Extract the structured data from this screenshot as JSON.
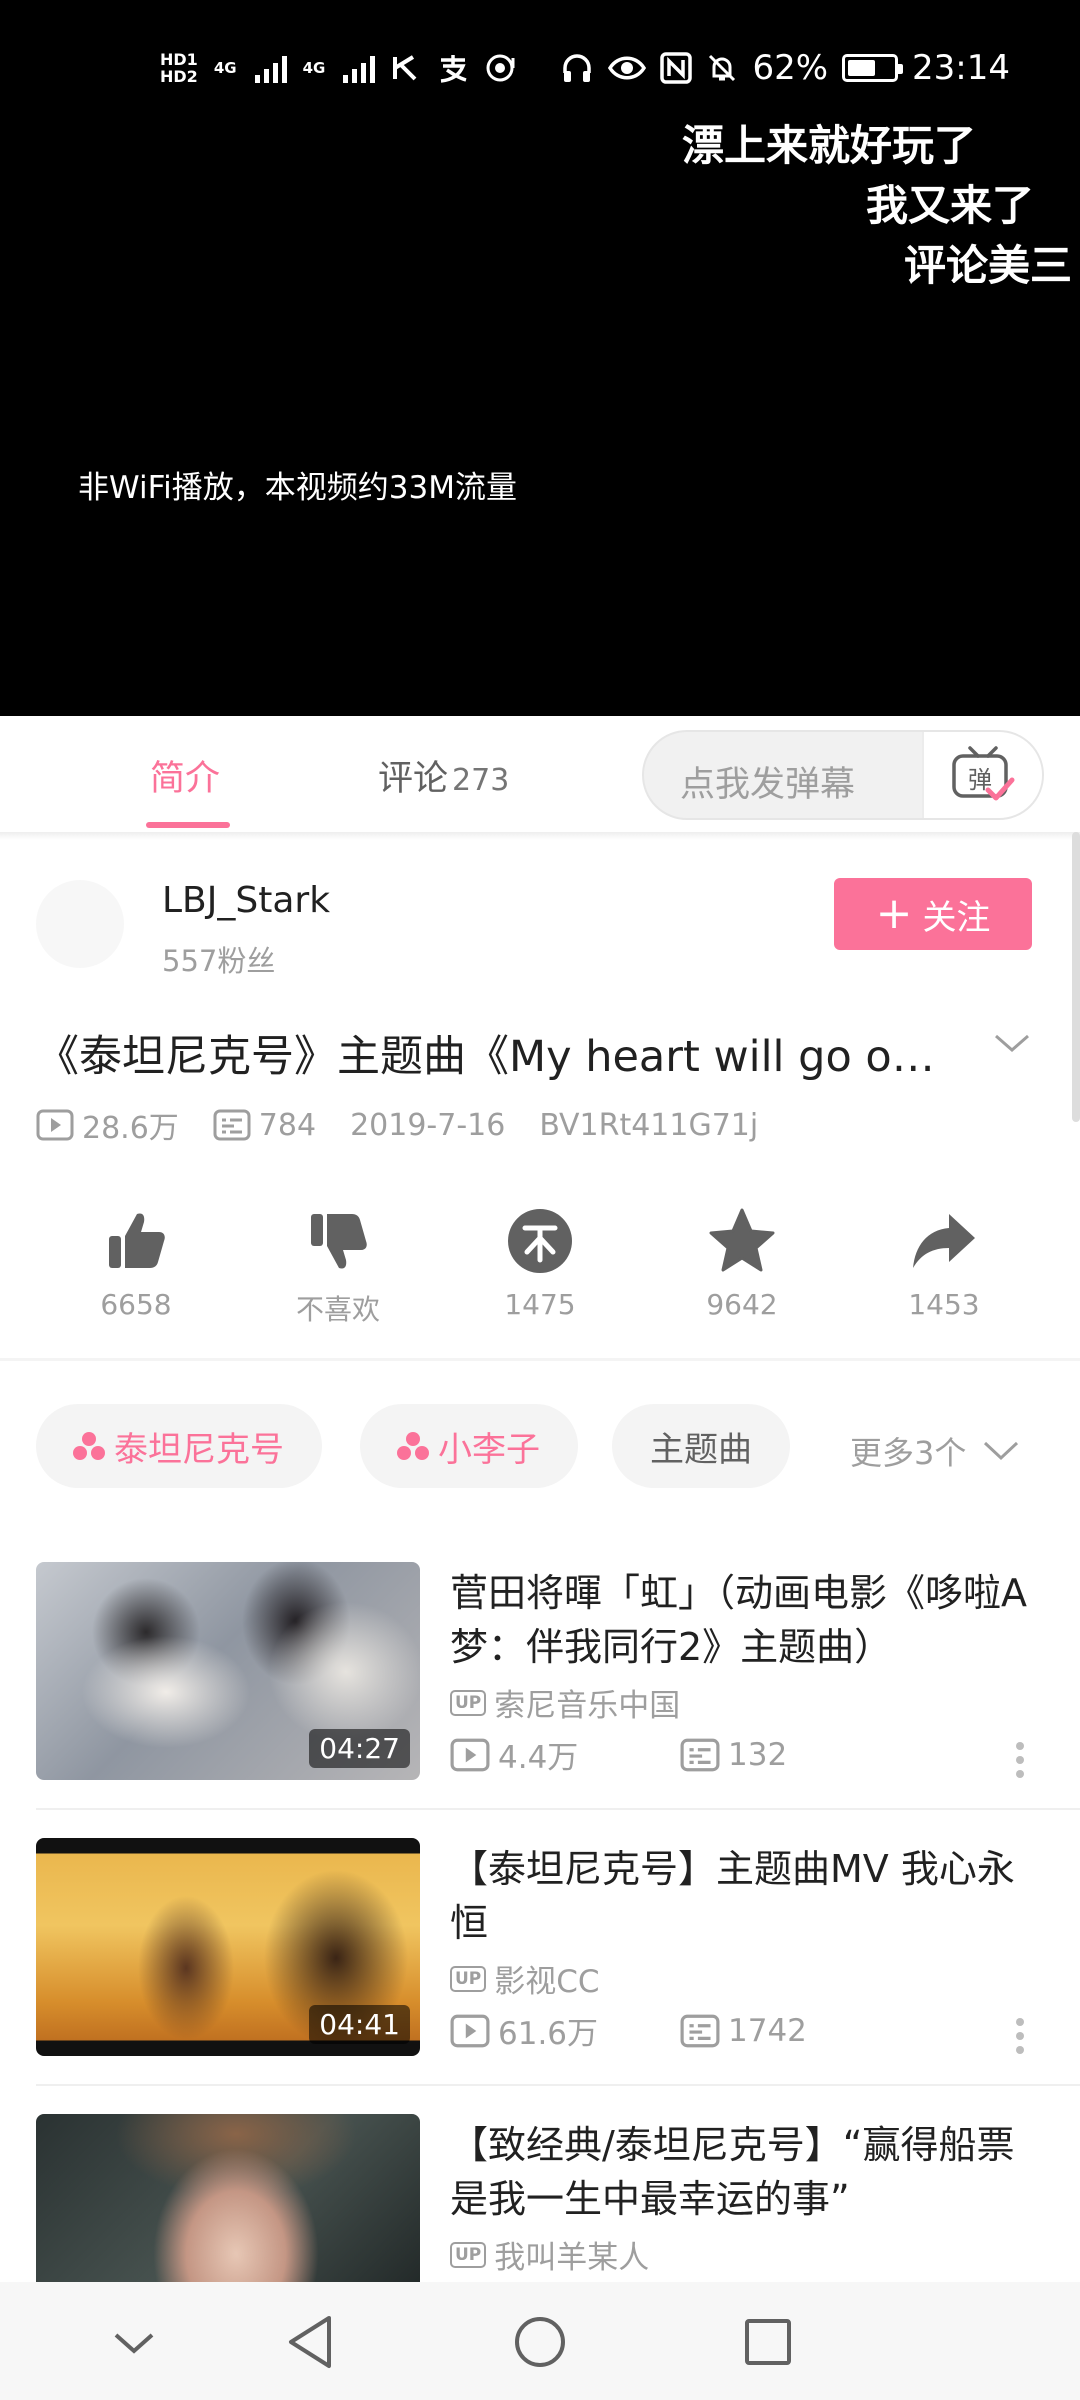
{
  "status_bar": {
    "hd1": "HD1",
    "hd2": "HD2",
    "net1": "4G",
    "net2": "4G",
    "battery": "62%",
    "battery_level": 0.62,
    "time": "23:14"
  },
  "player": {
    "danmaku": [
      "漂上来就好玩了",
      "我又来了",
      "评论美三"
    ],
    "traffic_note": "非WiFi播放，本视频约33M流量"
  },
  "tabs": {
    "intro": "简介",
    "comments": "评论",
    "comment_count": "273",
    "danmaku_placeholder": "点我发弹幕",
    "danmaku_button": "弹"
  },
  "uploader": {
    "name": "LBJ_Stark",
    "fans": "557粉丝",
    "follow_label": "关注"
  },
  "video": {
    "title": "《泰坦尼克号》主题曲《My heart will go on》",
    "views": "28.6万",
    "danmaku_count": "784",
    "date": "2019-7-16",
    "bvid": "BV1Rt411G71j"
  },
  "actions": [
    {
      "icon": "thumbs-up-icon",
      "label": "6658"
    },
    {
      "icon": "thumbs-down-icon",
      "label": "不喜欢"
    },
    {
      "icon": "coin-icon",
      "label": "1475"
    },
    {
      "icon": "star-icon",
      "label": "9642"
    },
    {
      "icon": "share-icon",
      "label": "1453"
    }
  ],
  "tags": [
    {
      "label": "泰坦尼克号",
      "style": "pink"
    },
    {
      "label": "小李子",
      "style": "pink"
    },
    {
      "label": "主题曲",
      "style": "grey"
    }
  ],
  "more_tags": "更多3个",
  "recommendations": [
    {
      "title": "菅田将暉「虹」（动画电影《哆啦A梦：伴我同行2》主题曲）",
      "up_badge": "UP",
      "up": "索尼音乐中国",
      "views": "4.4万",
      "danmaku": "132",
      "duration": "04:27"
    },
    {
      "title": "【泰坦尼克号】主题曲MV 我心永恒",
      "up_badge": "UP",
      "up": "影视CC",
      "views": "61.6万",
      "danmaku": "1742",
      "duration": "04:41"
    },
    {
      "title": "【致经典/泰坦尼克号】“赢得船票是我一生中最幸运的事”",
      "up_badge": "UP",
      "up": "我叫羊某人"
    }
  ],
  "colors": {
    "accent": "#fb7299",
    "secondary_text": "#9e9e9e",
    "icon_grey": "#616161"
  }
}
